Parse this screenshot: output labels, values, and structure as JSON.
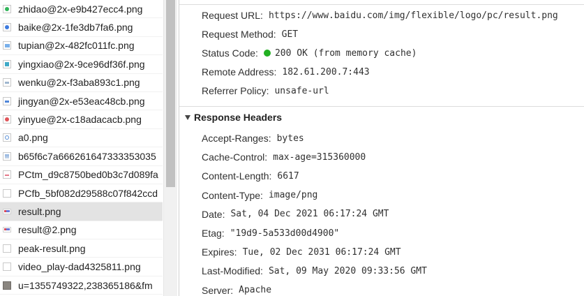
{
  "requests": [
    {
      "name": "zhidao@2x-e9b427ecc4.png",
      "icon": "green-dot-icon",
      "cls": "green"
    },
    {
      "name": "baike@2x-1fe3db7fa6.png",
      "icon": "blue-dot-icon",
      "cls": "blue"
    },
    {
      "name": "tupian@2x-482fc011fc.png",
      "icon": "image-icon",
      "cls": "lightblue"
    },
    {
      "name": "yingxiao@2x-9ce96df36f.png",
      "icon": "teal-square-icon",
      "cls": "teal"
    },
    {
      "name": "wenku@2x-f3aba893c1.png",
      "icon": "document-icon",
      "cls": "gray"
    },
    {
      "name": "jingyan@2x-e53eac48cb.png",
      "icon": "blue-bar-icon",
      "cls": "bluebar"
    },
    {
      "name": "yinyue@2x-c18adacacb.png",
      "icon": "red-dot-icon",
      "cls": "red"
    },
    {
      "name": "a0.png",
      "icon": "ring-icon",
      "cls": "ring"
    },
    {
      "name": "b65f6c7a666261647333353035",
      "icon": "image-icon",
      "cls": "img"
    },
    {
      "name": "PCtm_d9c8750bed0b3c7d089fa",
      "icon": "pink-bar-icon",
      "cls": "pinkbar"
    },
    {
      "name": "PCfb_5bf082d29588c07f842ccd",
      "icon": "blank-file-icon",
      "cls": "empty"
    },
    {
      "name": "result.png",
      "icon": "thumbnail-icon",
      "cls": "thumb",
      "selected": true
    },
    {
      "name": "result@2.png",
      "icon": "thumbnail-icon",
      "cls": "thumb"
    },
    {
      "name": "peak-result.png",
      "icon": "blank-file-icon",
      "cls": "empty"
    },
    {
      "name": "video_play-dad4325811.png",
      "icon": "blank-file-icon",
      "cls": "empty"
    },
    {
      "name": "u=1355749322,238365186&fm",
      "icon": "photo-icon",
      "cls": "photo"
    }
  ],
  "general": {
    "request_url_label": "Request URL:",
    "request_url": "https://www.baidu.com/img/flexible/logo/pc/result.png",
    "method_label": "Request Method:",
    "method": "GET",
    "status_label": "Status Code:",
    "status": "200 OK (from memory cache)",
    "status_color": "#22b022",
    "remote_label": "Remote Address:",
    "remote": "182.61.200.7:443",
    "referrer_label": "Referrer Policy:",
    "referrer": "unsafe-url"
  },
  "response_headers": {
    "title": "Response Headers",
    "items": [
      {
        "key": "Accept-Ranges:",
        "value": "bytes"
      },
      {
        "key": "Cache-Control:",
        "value": "max-age=315360000"
      },
      {
        "key": "Content-Length:",
        "value": "6617"
      },
      {
        "key": "Content-Type:",
        "value": "image/png"
      },
      {
        "key": "Date:",
        "value": "Sat, 04 Dec 2021 06:17:24 GMT"
      },
      {
        "key": "Etag:",
        "value": "\"19d9-5a533d00d4900\""
      },
      {
        "key": "Expires:",
        "value": "Tue, 02 Dec 2031 06:17:24 GMT"
      },
      {
        "key": "Last-Modified:",
        "value": "Sat, 09 May 2020 09:33:56 GMT"
      },
      {
        "key": "Server:",
        "value": "Apache"
      }
    ]
  }
}
